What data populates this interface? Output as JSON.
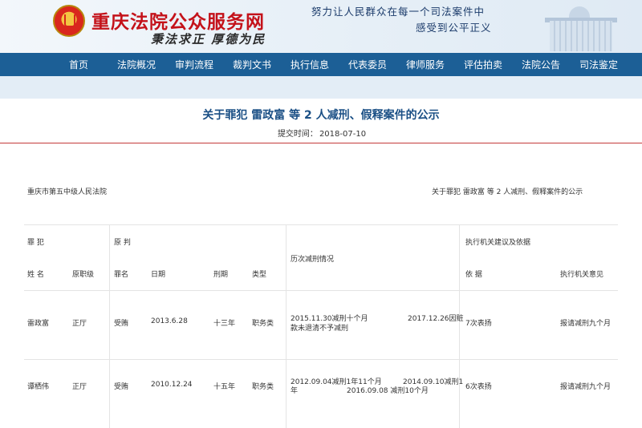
{
  "header": {
    "site_title": "重庆法院公众服务网",
    "motto": "秉法求正 厚德为民",
    "slogan_line1": "努力让人民群众在每一个司法案件中",
    "slogan_line2": "感受到公平正义",
    "brand_color": "#c4121a",
    "nav_color": "#1c5f96"
  },
  "nav": {
    "items": [
      "首页",
      "法院概况",
      "审判流程",
      "裁判文书",
      "执行信息",
      "代表委员",
      "律师服务",
      "评估拍卖",
      "法院公告",
      "司法鉴定"
    ]
  },
  "notice": {
    "title": "关于罪犯 雷政富 等 2 人减刑、假释案件的公示",
    "submit_label": "提交时间：",
    "submit_date": "2018-07-10"
  },
  "document": {
    "court_name": "重庆市第五中级人民法院",
    "subject": "关于罪犯 雷政富 等 2 人减刑、假释案件的公示",
    "group_headers": {
      "criminal": "罪 犯",
      "original_sentence": "原 判",
      "history": "历次减刑情况",
      "agency": "执行机关建议及依据"
    },
    "columns": {
      "name": "姓 名",
      "former_post": "原职级",
      "charge": "罪名",
      "date": "日期",
      "term": "刑期",
      "type": "类型",
      "basis": "依 据",
      "opinion": "执行机关意见"
    },
    "rows": [
      {
        "name": "雷政富",
        "former_post": "正厅",
        "charge": "受贿",
        "date": "2013.6.28",
        "term": "十三年",
        "type": "职务类",
        "history_a": "2015.11.30减刑十个月",
        "history_b": "2017.12.26因赃",
        "history_c": "款未退清不予减刑",
        "basis": "7次表扬",
        "opinion": "报请减刑九个月"
      },
      {
        "name": "谭栖伟",
        "former_post": "正厅",
        "charge": "受贿",
        "date": "2010.12.24",
        "term": "十五年",
        "type": "职务类",
        "history_a": "2012.09.04减刑1年11个月",
        "history_b": "2014.09.10减刑1",
        "history_c": "年",
        "history_d": "2016.09.08 减刑10个月",
        "basis": "6次表扬",
        "opinion": "报请减刑九个月"
      }
    ]
  }
}
